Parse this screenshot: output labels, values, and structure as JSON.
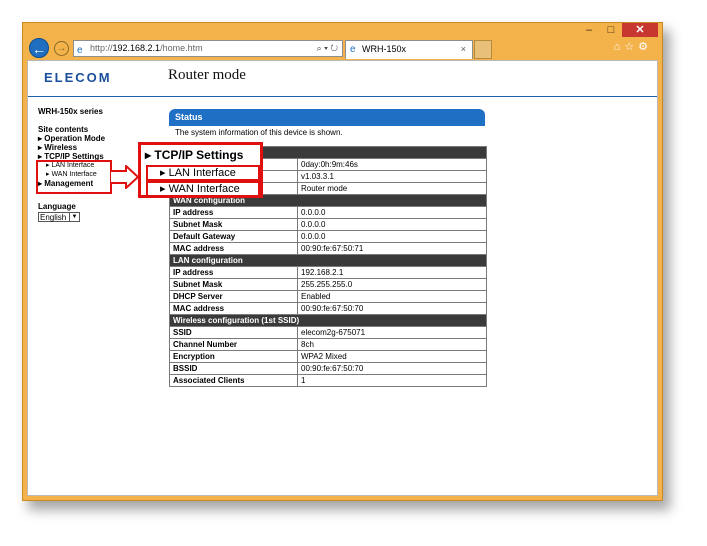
{
  "browser": {
    "window_controls": {
      "minimize": "–",
      "maximize": "□",
      "close": "✕"
    },
    "address_prefix": "http://",
    "address_host": "192.168.2.1",
    "address_path": "/home.htm",
    "address_tools": "⌕ ▾ ↻",
    "tab_title": "WRH-150x",
    "tab_close": "×",
    "right_tools": "⌂☆⚙",
    "icons": [
      "back-arrow-icon",
      "forward-arrow-icon",
      "ie-icon",
      "search-icon",
      "refresh-icon",
      "home-icon",
      "star-icon",
      "gear-icon"
    ]
  },
  "header": {
    "logo": "ELECOM",
    "mode": "Router mode"
  },
  "sidebar": {
    "series": "WRH-150x series",
    "site_contents": "Site contents",
    "items": [
      {
        "label": "▸ Operation Mode"
      },
      {
        "label": "▸ Wireless"
      },
      {
        "label": "▸ TCP/IP Settings"
      },
      {
        "label": "▸ LAN Interface",
        "sub": true
      },
      {
        "label": "▸ WAN Interface",
        "sub": true
      },
      {
        "label": "▸ Management"
      }
    ],
    "language_label": "Language",
    "language_value": "English"
  },
  "callout": {
    "title": "▸ TCP/IP Settings",
    "items": [
      "▸ LAN Interface",
      "▸ WAN Interface"
    ]
  },
  "status": {
    "title": "Status",
    "description": "The system information of this device is shown.",
    "system": [
      {
        "k": "",
        "v": "0day:0h:9m:46s"
      },
      {
        "k": "",
        "v": "v1.03.3.1"
      },
      {
        "k": "",
        "v": "Router mode"
      }
    ],
    "wan_title": "WAN configuration",
    "wan": [
      {
        "k": "IP address",
        "v": "0.0.0.0"
      },
      {
        "k": "Subnet Mask",
        "v": "0.0.0.0"
      },
      {
        "k": "Default Gateway",
        "v": "0.0.0.0"
      },
      {
        "k": "MAC address",
        "v": "00:90:fe:67:50:71"
      }
    ],
    "lan_title": "LAN configuration",
    "lan": [
      {
        "k": "IP address",
        "v": "192.168.2.1"
      },
      {
        "k": "Subnet Mask",
        "v": "255.255.255.0"
      },
      {
        "k": "DHCP Server",
        "v": "Enabled"
      },
      {
        "k": "MAC address",
        "v": "00:90:fe:67:50:70"
      }
    ],
    "wl_title": "Wireless configuration (1st SSID)",
    "wl": [
      {
        "k": "SSID",
        "v": "elecom2g-675071"
      },
      {
        "k": "Channel Number",
        "v": "8ch"
      },
      {
        "k": "Encryption",
        "v": "WPA2 Mixed"
      },
      {
        "k": "BSSID",
        "v": "00:90:fe:67:50:70"
      },
      {
        "k": "Associated Clients",
        "v": "1"
      }
    ]
  },
  "colors": {
    "frame": "#f3b24a",
    "status_blue": "#1f6fc4",
    "section_dark": "#3a3a3a",
    "highlight_red": "#e01010",
    "brand_blue": "#1a4f9c"
  }
}
